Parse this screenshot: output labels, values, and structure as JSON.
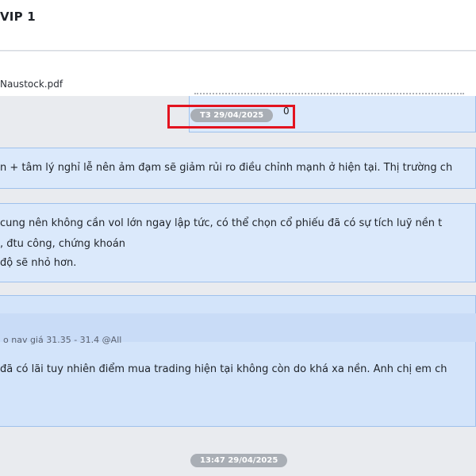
{
  "header": {
    "title": "VIP 1"
  },
  "attachment": {
    "file_name": "Naustock.pdf"
  },
  "timestamps": {
    "first": "T3 29/04/2025",
    "second": "13:47 29/04/2025",
    "trailing_char": "0"
  },
  "messages": [
    {
      "lines": [
        "n + tâm lý nghỉ lễ nên ảm đạm sẽ giảm rủi ro điều chỉnh mạnh ở hiện tại. Thị trường ch"
      ]
    },
    {
      "lines": [
        "cung nên không cần vol lớn ngay lập tức, có thể chọn cổ phiếu đã có sự tích luỹ nền t",
        ", đtu công, chứng khoán",
        "độ sẽ nhỏ hơn."
      ]
    },
    {
      "reply_preview": "o nav giá 31.35 - 31.4 @All",
      "lines": [
        "đã có lãi tuy nhiên điểm mua trading hiện tại không còn do khá xa nền. Anh chị em ch"
      ]
    }
  ],
  "colors": {
    "bubble": "#dbe9fb",
    "bubble_border": "#9fc1ec",
    "highlight": "#e3131f",
    "time_chip": "#a9aeb5"
  }
}
